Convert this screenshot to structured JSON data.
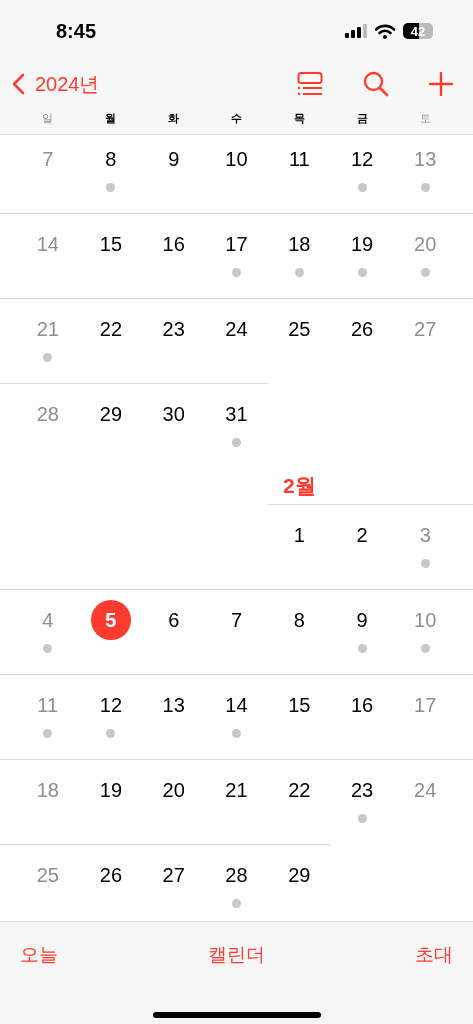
{
  "status_bar": {
    "time": "8:45",
    "battery": "42"
  },
  "nav": {
    "back": "2024년"
  },
  "weekdays": [
    "일",
    "월",
    "화",
    "수",
    "목",
    "금",
    "토"
  ],
  "months": [
    {
      "weeks": [
        [
          {
            "kind": "day",
            "n": "7",
            "dot": false,
            "today": false
          },
          {
            "kind": "day",
            "n": "8",
            "dot": true,
            "today": false
          },
          {
            "kind": "day",
            "n": "9",
            "dot": false,
            "today": false
          },
          {
            "kind": "day",
            "n": "10",
            "dot": false,
            "today": false
          },
          {
            "kind": "day",
            "n": "11",
            "dot": false,
            "today": false
          },
          {
            "kind": "day",
            "n": "12",
            "dot": true,
            "today": false
          },
          {
            "kind": "day",
            "n": "13",
            "dot": true,
            "today": false
          }
        ],
        [
          {
            "kind": "day",
            "n": "14",
            "dot": false,
            "today": false
          },
          {
            "kind": "day",
            "n": "15",
            "dot": false,
            "today": false
          },
          {
            "kind": "day",
            "n": "16",
            "dot": false,
            "today": false
          },
          {
            "kind": "day",
            "n": "17",
            "dot": true,
            "today": false
          },
          {
            "kind": "day",
            "n": "18",
            "dot": true,
            "today": false
          },
          {
            "kind": "day",
            "n": "19",
            "dot": true,
            "today": false
          },
          {
            "kind": "day",
            "n": "20",
            "dot": true,
            "today": false
          }
        ],
        [
          {
            "kind": "day",
            "n": "21",
            "dot": true,
            "today": false
          },
          {
            "kind": "day",
            "n": "22",
            "dot": false,
            "today": false
          },
          {
            "kind": "day",
            "n": "23",
            "dot": false,
            "today": false
          },
          {
            "kind": "day",
            "n": "24",
            "dot": false,
            "today": false
          },
          {
            "kind": "day",
            "n": "25",
            "dot": false,
            "today": false
          },
          {
            "kind": "day",
            "n": "26",
            "dot": false,
            "today": false
          },
          {
            "kind": "day",
            "n": "27",
            "dot": false,
            "today": false
          }
        ],
        [
          {
            "kind": "day",
            "n": "28",
            "dot": false,
            "today": false
          },
          {
            "kind": "day",
            "n": "29",
            "dot": false,
            "today": false
          },
          {
            "kind": "day",
            "n": "30",
            "dot": false,
            "today": false
          },
          {
            "kind": "day",
            "n": "31",
            "dot": true,
            "today": false
          },
          {
            "kind": "blank"
          },
          {
            "kind": "blank"
          },
          {
            "kind": "blank"
          }
        ]
      ]
    },
    {
      "label": "2월",
      "weeks": [
        [
          {
            "kind": "blank"
          },
          {
            "kind": "blank"
          },
          {
            "kind": "blank"
          },
          {
            "kind": "blank"
          },
          {
            "kind": "day",
            "n": "1",
            "dot": false,
            "today": false
          },
          {
            "kind": "day",
            "n": "2",
            "dot": false,
            "today": false
          },
          {
            "kind": "day",
            "n": "3",
            "dot": true,
            "today": false
          }
        ],
        [
          {
            "kind": "day",
            "n": "4",
            "dot": true,
            "today": false
          },
          {
            "kind": "day",
            "n": "5",
            "dot": false,
            "today": true
          },
          {
            "kind": "day",
            "n": "6",
            "dot": false,
            "today": false
          },
          {
            "kind": "day",
            "n": "7",
            "dot": false,
            "today": false
          },
          {
            "kind": "day",
            "n": "8",
            "dot": false,
            "today": false
          },
          {
            "kind": "day",
            "n": "9",
            "dot": true,
            "today": false
          },
          {
            "kind": "day",
            "n": "10",
            "dot": true,
            "today": false
          }
        ],
        [
          {
            "kind": "day",
            "n": "11",
            "dot": true,
            "today": false
          },
          {
            "kind": "day",
            "n": "12",
            "dot": true,
            "today": false
          },
          {
            "kind": "day",
            "n": "13",
            "dot": false,
            "today": false
          },
          {
            "kind": "day",
            "n": "14",
            "dot": true,
            "today": false
          },
          {
            "kind": "day",
            "n": "15",
            "dot": false,
            "today": false
          },
          {
            "kind": "day",
            "n": "16",
            "dot": false,
            "today": false
          },
          {
            "kind": "day",
            "n": "17",
            "dot": false,
            "today": false
          }
        ],
        [
          {
            "kind": "day",
            "n": "18",
            "dot": false,
            "today": false
          },
          {
            "kind": "day",
            "n": "19",
            "dot": false,
            "today": false
          },
          {
            "kind": "day",
            "n": "20",
            "dot": false,
            "today": false
          },
          {
            "kind": "day",
            "n": "21",
            "dot": false,
            "today": false
          },
          {
            "kind": "day",
            "n": "22",
            "dot": false,
            "today": false
          },
          {
            "kind": "day",
            "n": "23",
            "dot": true,
            "today": false
          },
          {
            "kind": "day",
            "n": "24",
            "dot": false,
            "today": false
          }
        ],
        [
          {
            "kind": "day",
            "n": "25",
            "dot": false,
            "today": false
          },
          {
            "kind": "day",
            "n": "26",
            "dot": false,
            "today": false
          },
          {
            "kind": "day",
            "n": "27",
            "dot": false,
            "today": false
          },
          {
            "kind": "day",
            "n": "28",
            "dot": true,
            "today": false
          },
          {
            "kind": "day",
            "n": "29",
            "dot": false,
            "today": false
          },
          {
            "kind": "blank"
          },
          {
            "kind": "blank"
          }
        ]
      ]
    }
  ],
  "bottom_bar": {
    "left": "오늘",
    "center": "캘린더",
    "right": "초대"
  }
}
